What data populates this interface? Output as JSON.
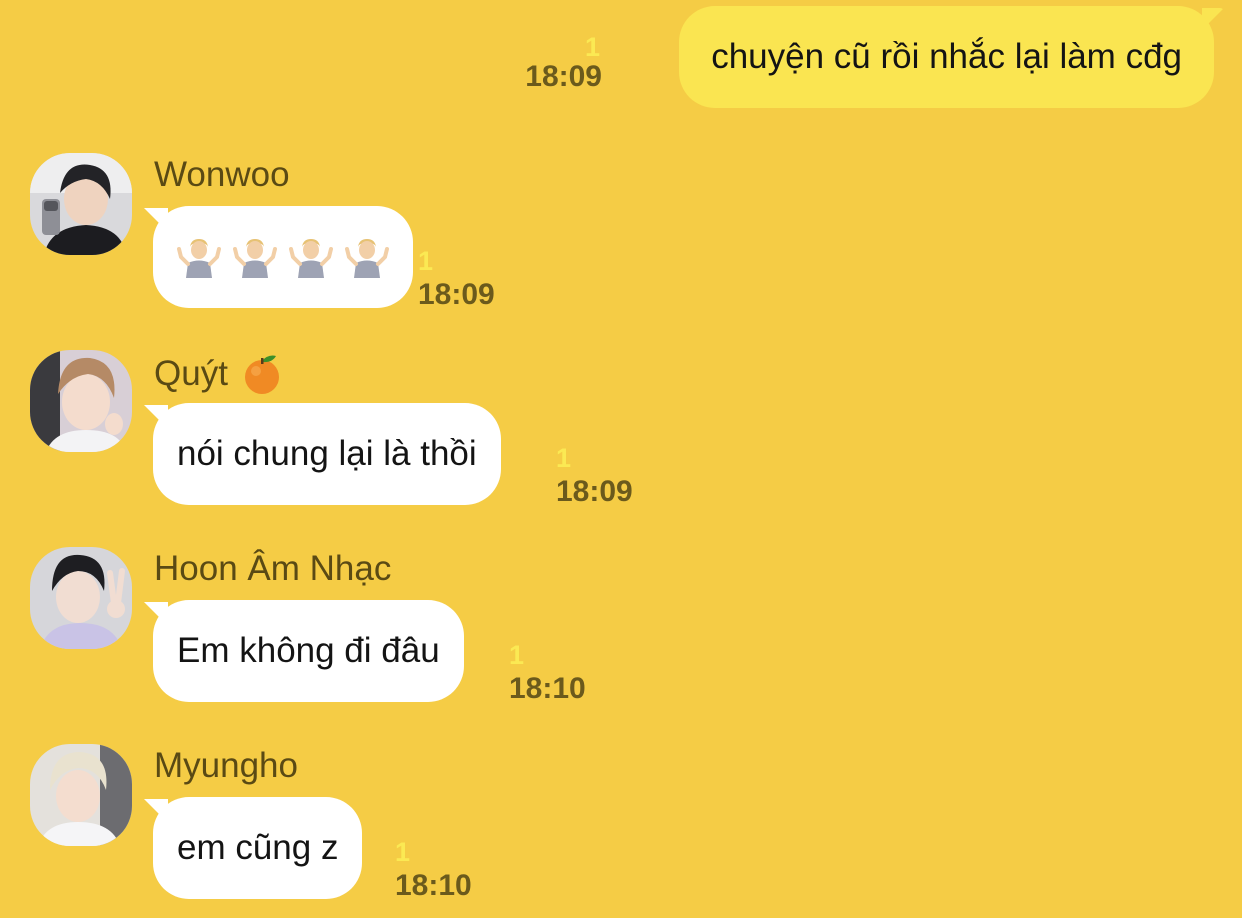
{
  "messages": [
    {
      "direction": "outgoing",
      "text": "chuyện cũ rồi nhắc lại làm cđg",
      "unread_count": "1",
      "time": "18:09"
    },
    {
      "direction": "incoming",
      "sender": "Wonwoo",
      "emoji_icons": [
        "person-shrugging-icon",
        "person-shrugging-icon",
        "person-shrugging-icon",
        "person-shrugging-icon"
      ],
      "unread_count": "1",
      "time": "18:09"
    },
    {
      "direction": "incoming",
      "sender": "Quýt",
      "sender_icon": "tangerine-icon",
      "text": "nói chung lại là thồi",
      "unread_count": "1",
      "time": "18:09"
    },
    {
      "direction": "incoming",
      "sender": "Hoon Âm Nhạc",
      "text": "Em không đi đâu",
      "unread_count": "1",
      "time": "18:10"
    },
    {
      "direction": "incoming",
      "sender": "Myungho",
      "text": "em cũng z",
      "unread_count": "1",
      "time": "18:10"
    }
  ],
  "colors": {
    "background": "#f5cc45",
    "outgoing_bubble": "#fae551",
    "incoming_bubble": "#ffffff",
    "unread_count": "#fbe953",
    "meta_text": "#6b5a1c"
  }
}
